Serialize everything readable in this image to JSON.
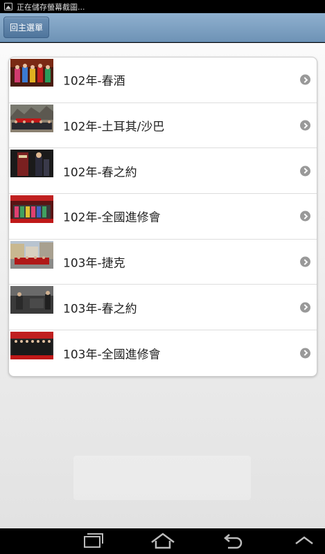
{
  "status_bar": {
    "text": "正在儲存螢幕截圖...",
    "icon": "picture-icon"
  },
  "header": {
    "back_label": "回主選單"
  },
  "list": {
    "items": [
      {
        "label": "102年-春酒"
      },
      {
        "label": "102年-土耳其/沙巴"
      },
      {
        "label": "102年-春之約"
      },
      {
        "label": "102年-全國進修會"
      },
      {
        "label": "103年-捷克"
      },
      {
        "label": "103年-春之約"
      },
      {
        "label": "103年-全國進修會"
      }
    ]
  },
  "nav_bar": {
    "icons": [
      "recent-apps-icon",
      "home-icon",
      "back-icon",
      "menu-up-icon"
    ]
  },
  "colors": {
    "header": "#7fa2c4",
    "back_button": "#5a80a7",
    "chevron": "#999999"
  }
}
